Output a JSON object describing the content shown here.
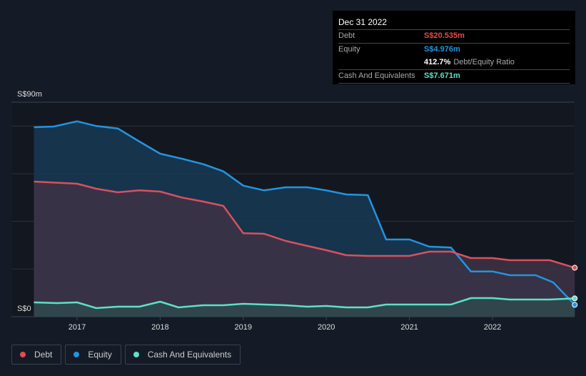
{
  "tooltip": {
    "date": "Dec 31 2022",
    "debt_label": "Debt",
    "debt_value": "S$20.535m",
    "equity_label": "Equity",
    "equity_value": "S$4.976m",
    "ratio_value": "412.7%",
    "ratio_label": "Debt/Equity Ratio",
    "cash_label": "Cash And Equivalents",
    "cash_value": "S$7.671m"
  },
  "legend": [
    {
      "label": "Debt",
      "color": "#e64b4b"
    },
    {
      "label": "Equity",
      "color": "#2394df"
    },
    {
      "label": "Cash And Equivalents",
      "color": "#5de0c8"
    }
  ],
  "chart_data": {
    "type": "area",
    "ylabel_top": "S$90m",
    "ylabel_bottom": "S$0",
    "ylim": [
      0,
      90
    ],
    "xlim": [
      2016.2,
      2023.0
    ],
    "grid_values": [
      0,
      20,
      40,
      60,
      80,
      90
    ],
    "x_ticks": [
      2017,
      2018,
      2019,
      2020,
      2021,
      2022
    ],
    "x_tick_labels": [
      "2017",
      "2018",
      "2019",
      "2020",
      "2021",
      "2022"
    ],
    "series": [
      {
        "name": "Equity",
        "color": "#2394df",
        "fill": "#183a55",
        "points": [
          [
            2016.48,
            79.5
          ],
          [
            2016.72,
            79.8
          ],
          [
            2017.0,
            82
          ],
          [
            2017.23,
            80
          ],
          [
            2017.49,
            79
          ],
          [
            2017.75,
            73.5
          ],
          [
            2018.0,
            68.4
          ],
          [
            2018.26,
            66.3
          ],
          [
            2018.52,
            64
          ],
          [
            2018.76,
            61
          ],
          [
            2019.0,
            55
          ],
          [
            2019.25,
            53
          ],
          [
            2019.51,
            54.3
          ],
          [
            2019.77,
            54.3
          ],
          [
            2020.0,
            53
          ],
          [
            2020.24,
            51.3
          ],
          [
            2020.5,
            51
          ],
          [
            2020.72,
            32.4
          ],
          [
            2021.0,
            32.4
          ],
          [
            2021.24,
            29.4
          ],
          [
            2021.5,
            29
          ],
          [
            2021.74,
            19
          ],
          [
            2022.0,
            19
          ],
          [
            2022.21,
            17.4
          ],
          [
            2022.52,
            17.4
          ],
          [
            2022.73,
            14.4
          ],
          [
            2022.99,
            4.976
          ]
        ]
      },
      {
        "name": "Debt",
        "color": "#d9505e",
        "fill": "#3e3347",
        "points": [
          [
            2016.48,
            56.7
          ],
          [
            2017.0,
            55.8
          ],
          [
            2017.23,
            53.7
          ],
          [
            2017.49,
            52.2
          ],
          [
            2017.75,
            53
          ],
          [
            2018.0,
            52.5
          ],
          [
            2018.26,
            50
          ],
          [
            2018.52,
            48.3
          ],
          [
            2018.76,
            46.5
          ],
          [
            2019.0,
            35
          ],
          [
            2019.25,
            34.8
          ],
          [
            2019.51,
            31.8
          ],
          [
            2019.77,
            29.7
          ],
          [
            2020.0,
            27.9
          ],
          [
            2020.24,
            25.8
          ],
          [
            2020.5,
            25.5
          ],
          [
            2021.0,
            25.5
          ],
          [
            2021.24,
            27.3
          ],
          [
            2021.5,
            27.3
          ],
          [
            2021.74,
            24.6
          ],
          [
            2022.0,
            24.6
          ],
          [
            2022.21,
            23.7
          ],
          [
            2022.69,
            23.7
          ],
          [
            2022.99,
            20.535
          ]
        ]
      },
      {
        "name": "Cash And Equivalents",
        "color": "#5de0c8",
        "fill": "#2f4a4e",
        "points": [
          [
            2016.48,
            6
          ],
          [
            2016.76,
            5.7
          ],
          [
            2017.0,
            6
          ],
          [
            2017.23,
            3.6
          ],
          [
            2017.49,
            4.2
          ],
          [
            2017.75,
            4.2
          ],
          [
            2018.0,
            6.3
          ],
          [
            2018.22,
            3.9
          ],
          [
            2018.52,
            4.8
          ],
          [
            2018.76,
            4.8
          ],
          [
            2019.0,
            5.4
          ],
          [
            2019.25,
            5.1
          ],
          [
            2019.51,
            4.8
          ],
          [
            2019.77,
            4.2
          ],
          [
            2020.0,
            4.5
          ],
          [
            2020.24,
            3.9
          ],
          [
            2020.5,
            3.9
          ],
          [
            2020.72,
            5.1
          ],
          [
            2021.0,
            5.1
          ],
          [
            2021.5,
            5.1
          ],
          [
            2021.74,
            7.8
          ],
          [
            2022.0,
            7.8
          ],
          [
            2022.21,
            7.2
          ],
          [
            2022.69,
            7.2
          ],
          [
            2022.99,
            7.671
          ]
        ]
      }
    ]
  }
}
